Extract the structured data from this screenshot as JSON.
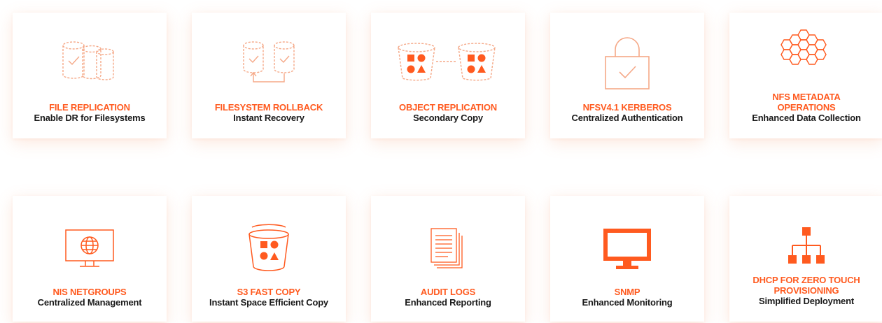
{
  "colors": {
    "accent": "#ff5a1f",
    "accent_light": "#f5a887",
    "text_dark": "#1a1a1a",
    "card_shadow": "#f28c5a"
  },
  "features": [
    {
      "title": "FILE REPLICATION",
      "subtitle": "Enable DR for Filesystems",
      "icon": "file-replication-icon"
    },
    {
      "title": "FILESYSTEM ROLLBACK",
      "subtitle": "Instant Recovery",
      "icon": "filesystem-rollback-icon"
    },
    {
      "title": "OBJECT REPLICATION",
      "subtitle": "Secondary Copy",
      "icon": "object-replication-icon"
    },
    {
      "title": "NFSV4.1 KERBEROS",
      "subtitle": "Centralized Authentication",
      "icon": "lock-icon"
    },
    {
      "title": "NFS METADATA OPERATIONS",
      "subtitle": "Enhanced Data Collection",
      "icon": "hexagon-cluster-icon"
    },
    {
      "title": "NIS NETGROUPS",
      "subtitle": "Centralized Management",
      "icon": "globe-monitor-icon"
    },
    {
      "title": "S3 FAST COPY",
      "subtitle": "Instant Space Efficient Copy",
      "icon": "bucket-shapes-icon"
    },
    {
      "title": "AUDIT LOGS",
      "subtitle": "Enhanced Reporting",
      "icon": "document-stack-icon"
    },
    {
      "title": "SNMP",
      "subtitle": "Enhanced Monitoring",
      "icon": "monitor-icon"
    },
    {
      "title": "DHCP FOR ZERO TOUCH PROVISIONING",
      "subtitle": "Simplified Deployment",
      "icon": "network-tree-icon"
    }
  ]
}
